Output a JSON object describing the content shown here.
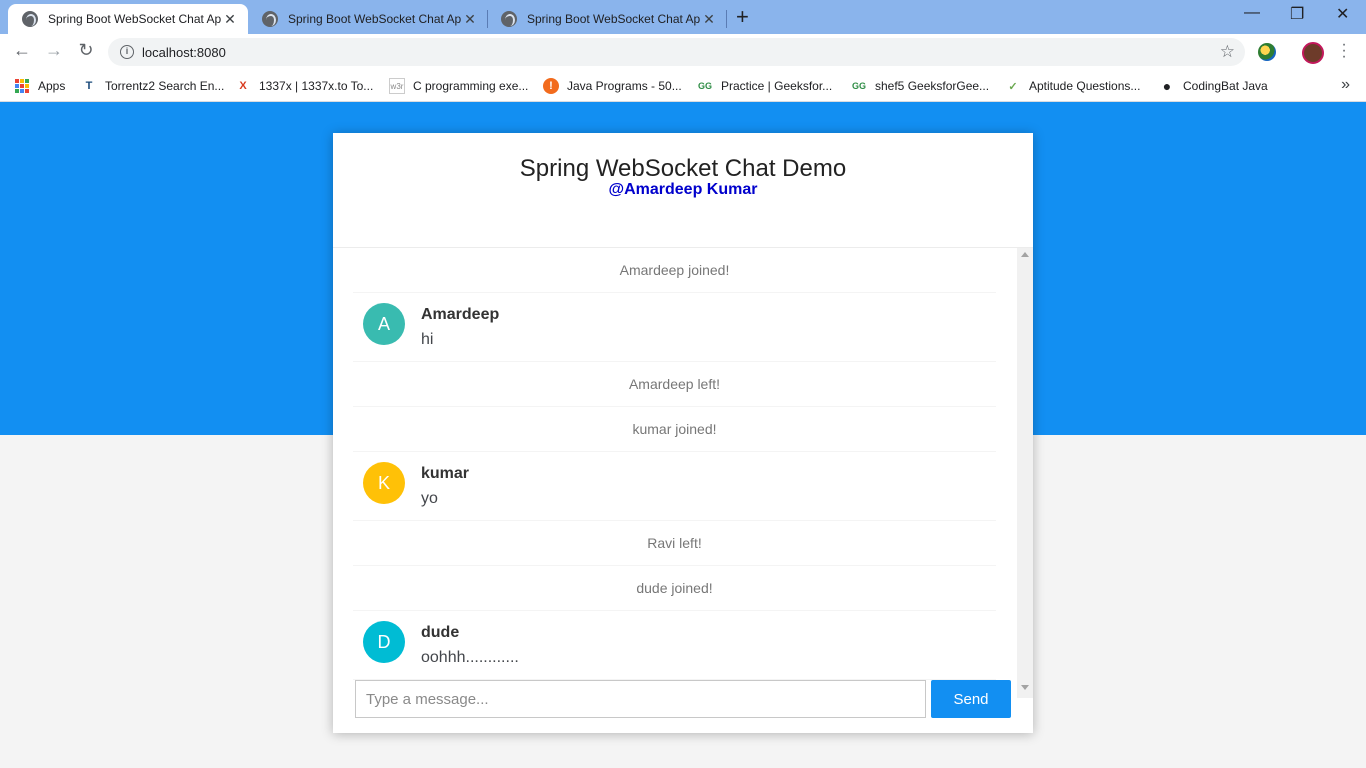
{
  "browser": {
    "tabs": [
      {
        "title": "Spring Boot WebSocket Chat App",
        "active": true
      },
      {
        "title": "Spring Boot WebSocket Chat App",
        "active": false
      },
      {
        "title": "Spring Boot WebSocket Chat App",
        "active": false
      }
    ],
    "close_glyph": "✕",
    "new_tab_glyph": "+",
    "window_controls": {
      "minimize": "—",
      "restore": "❐",
      "close": "✕"
    },
    "nav": {
      "back": "←",
      "forward": "→",
      "reload": "↻"
    },
    "url": "localhost:8080",
    "bookmarks": [
      {
        "label": "Apps",
        "icon": "apps-grid-icon"
      },
      {
        "label": "Torrentz2 Search En...",
        "icon": "torrentz-icon",
        "glyph": "T",
        "color": "#1a4a7a"
      },
      {
        "label": "1337x | 1337x.to To...",
        "icon": "x-logo-icon",
        "glyph": "X",
        "color": "#d83a1e"
      },
      {
        "label": "C programming exe...",
        "icon": "w3r-icon",
        "glyph": "w3r",
        "color": "#888888"
      },
      {
        "label": "Java Programs - 50...",
        "icon": "info-orange-icon",
        "glyph": "!",
        "color": "#f26b1d"
      },
      {
        "label": "Practice | Geeksfor...",
        "icon": "gfg-icon",
        "glyph": "GG",
        "color": "#2f8d46"
      },
      {
        "label": "shef5 GeeksforGee...",
        "icon": "gfg-icon",
        "glyph": "GG",
        "color": "#2f8d46"
      },
      {
        "label": "Aptitude Questions...",
        "icon": "leaf-icon",
        "glyph": "✓",
        "color": "#6aa84f"
      },
      {
        "label": "CodingBat Java",
        "icon": "globe-icon",
        "glyph": "●",
        "color": "#202124"
      }
    ],
    "more_glyph": "»"
  },
  "page": {
    "bg_color": "#128ff2",
    "title": "Spring WebSocket Chat Demo",
    "subtitle": "@Amardeep Kumar",
    "messages": [
      {
        "type": "event",
        "text": "Amardeep joined!"
      },
      {
        "type": "chat",
        "sender": "Amardeep",
        "initial": "A",
        "color": "#39bbb0",
        "text": "hi"
      },
      {
        "type": "event",
        "text": "Amardeep left!"
      },
      {
        "type": "event",
        "text": "kumar joined!"
      },
      {
        "type": "chat",
        "sender": "kumar",
        "initial": "K",
        "color": "#ffc107",
        "text": "yo"
      },
      {
        "type": "event",
        "text": "Ravi left!"
      },
      {
        "type": "event",
        "text": "dude joined!"
      },
      {
        "type": "chat",
        "sender": "dude",
        "initial": "D",
        "color": "#00bcd4",
        "text": "oohhh............"
      }
    ],
    "input_placeholder": "Type a message...",
    "input_value": "",
    "send_label": "Send"
  }
}
